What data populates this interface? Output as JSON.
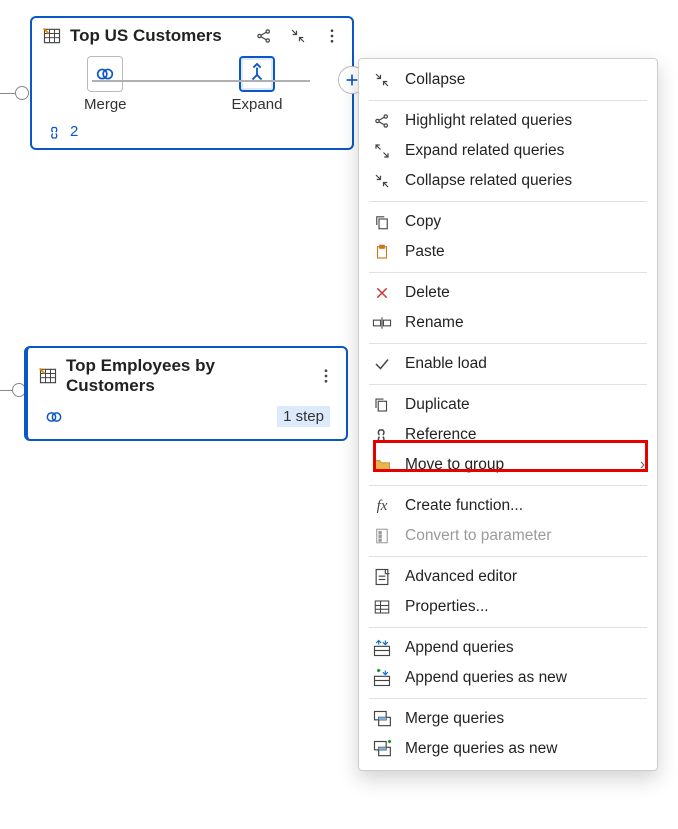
{
  "card1": {
    "title": "Top US Customers",
    "steps": [
      {
        "label": "Merge"
      },
      {
        "label": "Expand"
      }
    ],
    "ref_count": "2"
  },
  "card2": {
    "title": "Top Employees by Customers",
    "step_count": "1 step"
  },
  "menu": {
    "collapse": "Collapse",
    "highlight_related": "Highlight related queries",
    "expand_related": "Expand related queries",
    "collapse_related": "Collapse related queries",
    "copy": "Copy",
    "paste": "Paste",
    "delete": "Delete",
    "rename": "Rename",
    "enable_load": "Enable load",
    "duplicate": "Duplicate",
    "reference": "Reference",
    "move_to_group": "Move to group",
    "create_function": "Create function...",
    "convert_to_parameter": "Convert to parameter",
    "advanced_editor": "Advanced editor",
    "properties": "Properties...",
    "append_queries": "Append queries",
    "append_queries_new": "Append queries as new",
    "merge_queries": "Merge queries",
    "merge_queries_new": "Merge queries as new"
  }
}
